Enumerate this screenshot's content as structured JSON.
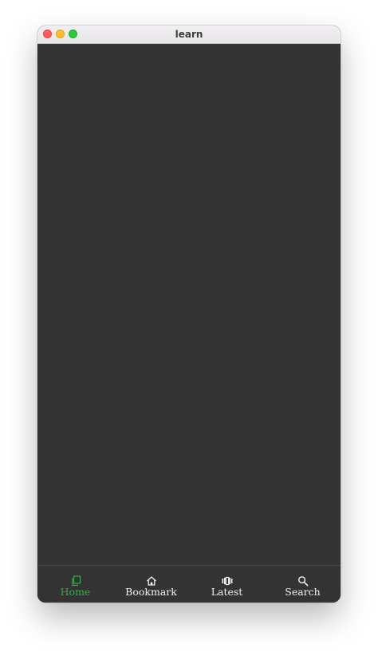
{
  "window": {
    "title": "learn"
  },
  "tabbar": {
    "active_color": "#3ea84c",
    "items": [
      {
        "label": "Home",
        "icon": "copy-icon",
        "active": true
      },
      {
        "label": "Bookmark",
        "icon": "home-icon",
        "active": false
      },
      {
        "label": "Latest",
        "icon": "carousel-icon",
        "active": false
      },
      {
        "label": "Search",
        "icon": "search-icon",
        "active": false
      }
    ]
  }
}
